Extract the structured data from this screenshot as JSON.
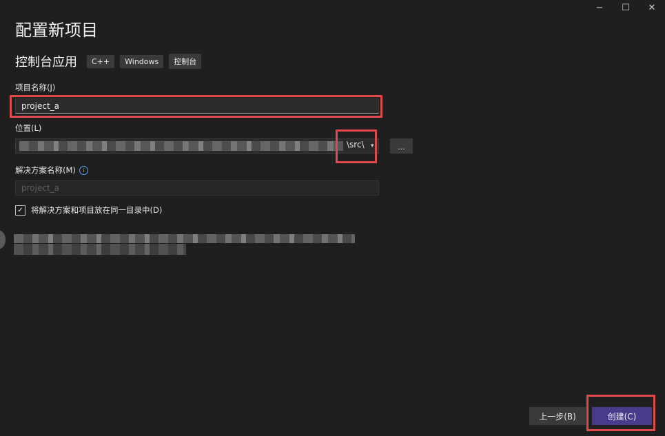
{
  "window": {
    "minimize": "−",
    "maximize": "☐",
    "close": "✕"
  },
  "page_title": "配置新项目",
  "template": {
    "name": "控制台应用",
    "tags": [
      "C++",
      "Windows",
      "控制台"
    ]
  },
  "project_name": {
    "label": "项目名称(J)",
    "value": "project_a"
  },
  "location": {
    "label": "位置(L)",
    "value_suffix": "\\src\\",
    "dropdown_icon": "chevron-down-icon",
    "browse_label": "..."
  },
  "solution_name": {
    "label": "解决方案名称(M)",
    "info_icon": "i",
    "placeholder": "project_a"
  },
  "same_dir": {
    "label": "将解决方案和项目放在同一目录中(D)",
    "checked": true,
    "check_glyph": "✓"
  },
  "buttons": {
    "back": "上一步(B)",
    "create": "创建(C)"
  },
  "colors": {
    "background": "#1f1f1f",
    "accent": "#4a3a8c",
    "highlight": "#e14a4a",
    "info": "#4fa3ff"
  }
}
